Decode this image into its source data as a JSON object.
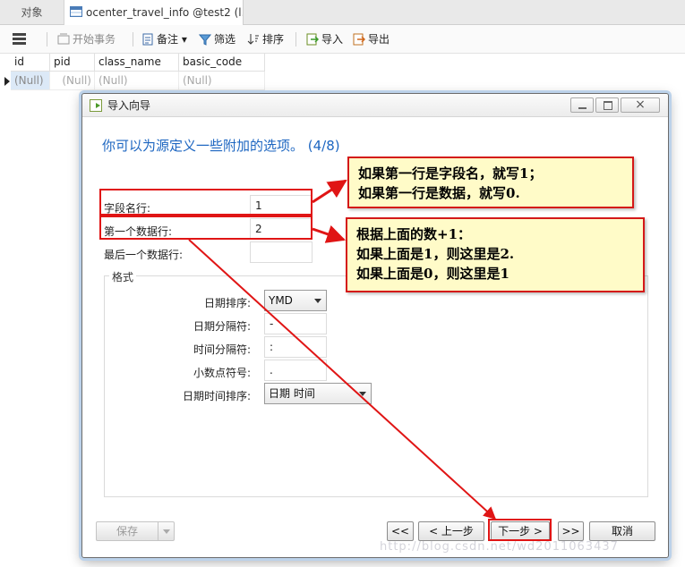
{
  "tabs": {
    "objects": "对象",
    "active": "ocenter_travel_info @test2 (l..."
  },
  "toolbar": {
    "begin_transaction": "开始事务",
    "comment": "备注",
    "filter": "筛选",
    "sort": "排序",
    "import": "导入",
    "export": "导出"
  },
  "grid": {
    "columns": [
      "id",
      "pid",
      "class_name",
      "basic_code"
    ],
    "row": [
      "(Null)",
      "(Null)",
      "(Null)",
      "(Null)"
    ]
  },
  "dialog": {
    "title": "导入向导",
    "heading": "你可以为源定义一些附加的选项。 (4/8)",
    "field_name_row": {
      "label": "字段名行:",
      "value": "1"
    },
    "first_data_row": {
      "label": "第一个数据行:",
      "value": "2"
    },
    "last_data_row": {
      "label": "最后一个数据行:",
      "value": ""
    },
    "format_group": "格式",
    "date_order": {
      "label": "日期排序:",
      "value": "YMD"
    },
    "date_separator": {
      "label": "日期分隔符:",
      "value": "-"
    },
    "time_separator": {
      "label": "时间分隔符:",
      "value": ":"
    },
    "decimal_symbol": {
      "label": "小数点符号:",
      "value": "."
    },
    "datetime_order": {
      "label": "日期时间排序:",
      "value": "日期 时间"
    },
    "buttons": {
      "save": "保存",
      "first": "<<",
      "prev": "< 上一步",
      "next": "下一步 >",
      "last": ">>",
      "cancel": "取消"
    }
  },
  "annotations": {
    "callout1": [
      "如果第一行是字段名，就写1；",
      "如果第一行是数据，就写0."
    ],
    "callout2": [
      "根据上面的数+1：",
      "如果上面是1，则这里是2.",
      "如果上面是0，则这里是1"
    ]
  },
  "watermark": "http://blog.csdn.net/wd2011063437",
  "colors": {
    "heading": "#1d66c1",
    "annotation_red": "#e01515",
    "callout_bg": "#fffbc8"
  }
}
